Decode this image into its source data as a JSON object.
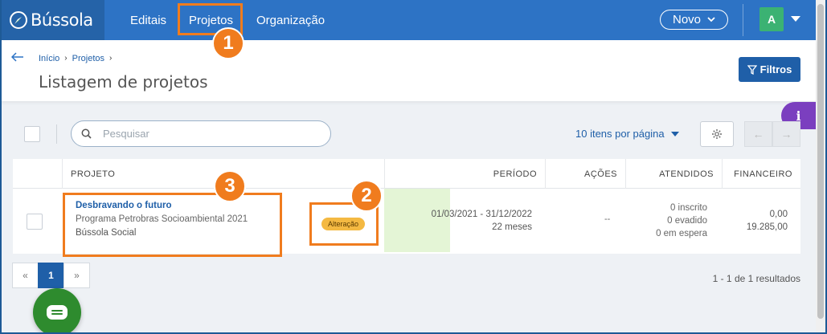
{
  "brand": {
    "name": "Bússola"
  },
  "nav": {
    "items": [
      "Editais",
      "Projetos",
      "Organização"
    ],
    "novo_label": "Novo",
    "avatar_initial": "A"
  },
  "header": {
    "breadcrumb": [
      "Início",
      "Projetos"
    ],
    "title": "Listagem de projetos",
    "filtros_label": "Filtros"
  },
  "info_label": "i",
  "toolbar": {
    "search_placeholder": "Pesquisar",
    "per_page": "10 itens por página"
  },
  "table": {
    "columns": [
      "PROJETO",
      "PERÍODO",
      "AÇÕES",
      "ATENDIDOS",
      "FINANCEIRO"
    ],
    "rows": [
      {
        "name": "Desbravando o futuro",
        "program": "Programa Petrobras Socioambiental 2021",
        "org": "Bússola Social",
        "status": "Alteração",
        "period_range": "01/03/2021 - 31/12/2022",
        "period_duration": "22 meses",
        "acoes": "--",
        "atendidos": [
          "0 inscrito",
          "0 evadido",
          "0 em espera"
        ],
        "financeiro": [
          "0,00",
          "19.285,00"
        ]
      }
    ]
  },
  "pagination": {
    "prev": "«",
    "current": "1",
    "next": "»",
    "results": "1 - 1 de 1 resultados"
  },
  "annotations": [
    "1",
    "2",
    "3"
  ],
  "colors": {
    "nav_bg": "#2d73c5",
    "brand_bg": "#2563a8",
    "primary": "#1f5fa8",
    "annotation": "#f07c1e",
    "badge": "#f4b942",
    "period_highlight": "#e4f5d6",
    "info_tab": "#7b3fbf",
    "chat": "#2e8b2e",
    "avatar": "#3bb273"
  }
}
